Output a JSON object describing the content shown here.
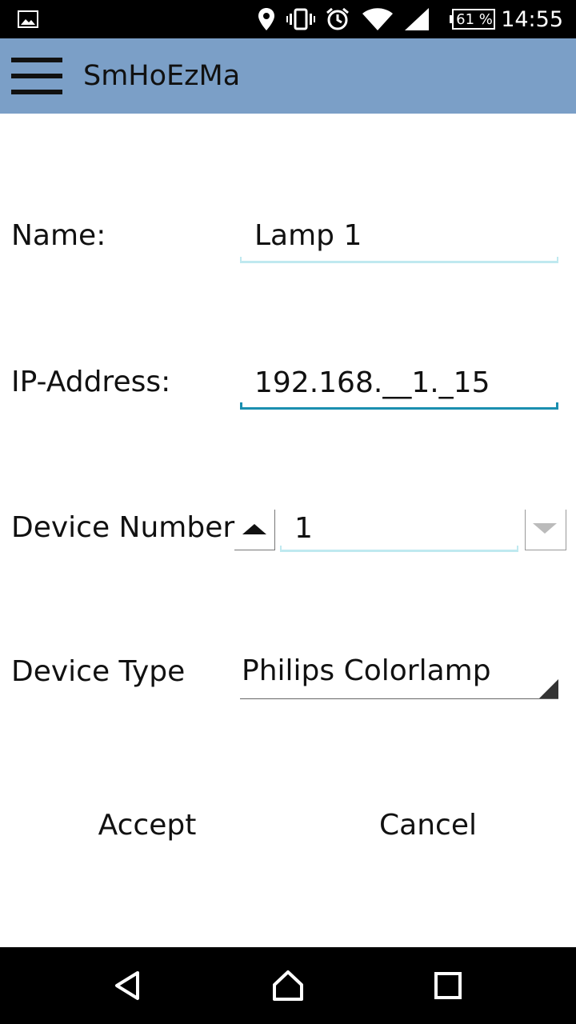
{
  "status_bar": {
    "icons": [
      "gallery-icon",
      "location-icon",
      "vibrate-icon",
      "alarm-icon",
      "wifi-icon",
      "signal-icon",
      "battery-icon"
    ],
    "battery": "61 %",
    "time": "14:55"
  },
  "app_bar": {
    "title": "SmHoEzMa",
    "menu_icon": "hamburger-menu-icon",
    "color": "#7b9fc7"
  },
  "form": {
    "name": {
      "label": "Name:",
      "value": "Lamp 1"
    },
    "ip": {
      "label": "IP-Address:",
      "value": "192.168.__1._15"
    },
    "device_number": {
      "label": "Device Number",
      "value": "1"
    },
    "device_type": {
      "label": "Device Type",
      "value": "Philips Colorlamp"
    }
  },
  "actions": {
    "accept": "Accept",
    "cancel": "Cancel"
  },
  "nav_bar": {
    "icons": [
      "back-icon",
      "home-icon",
      "recents-icon"
    ]
  }
}
